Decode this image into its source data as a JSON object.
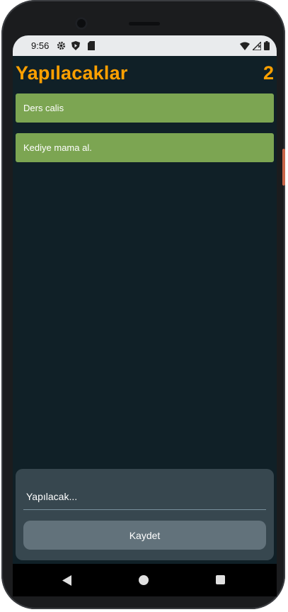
{
  "status_bar": {
    "time": "9:56",
    "icons_left": [
      "gear-icon",
      "shield-icon",
      "sd-card-icon"
    ],
    "icons_right": [
      "wifi-icon",
      "signal-icon",
      "battery-icon"
    ]
  },
  "header": {
    "title": "Yapılacaklar",
    "count": "2",
    "accent_color": "#ffa000"
  },
  "tasks": [
    {
      "label": "Ders calis"
    },
    {
      "label": "Kediye mama al."
    }
  ],
  "form": {
    "input_placeholder": "Yapılacak...",
    "input_value": "",
    "save_label": "Kaydet"
  },
  "colors": {
    "background": "#102027",
    "task_bg": "#7ca552",
    "panel_bg": "#37474f",
    "button_bg": "#62727b"
  }
}
